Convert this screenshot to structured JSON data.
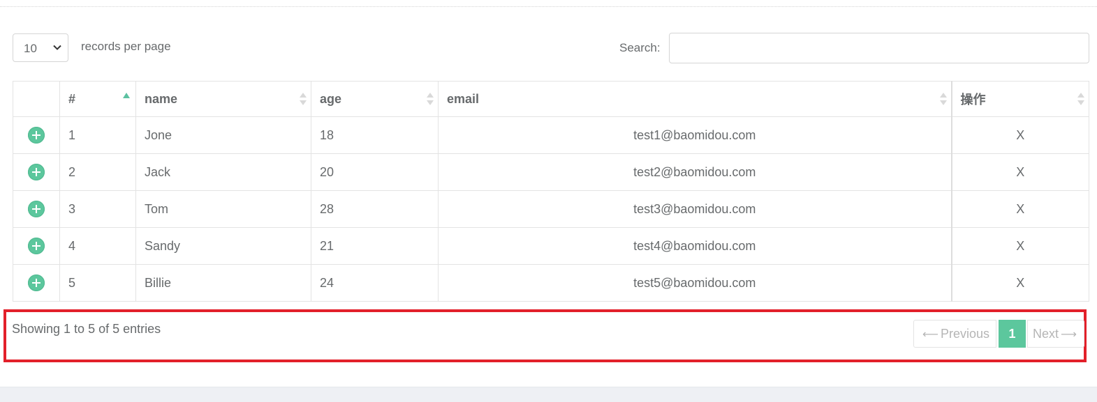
{
  "length_menu": {
    "selected": "10",
    "label": "records per page"
  },
  "search": {
    "label": "Search:",
    "value": "",
    "placeholder": ""
  },
  "table": {
    "columns": [
      "",
      "#",
      "name",
      "age",
      "email",
      "操作"
    ],
    "rows": [
      {
        "id": "1",
        "name": "Jone",
        "age": "18",
        "email": "test1@baomidou.com",
        "action": "X"
      },
      {
        "id": "2",
        "name": "Jack",
        "age": "20",
        "email": "test2@baomidou.com",
        "action": "X"
      },
      {
        "id": "3",
        "name": "Tom",
        "age": "28",
        "email": "test3@baomidou.com",
        "action": "X"
      },
      {
        "id": "4",
        "name": "Sandy",
        "age": "21",
        "email": "test4@baomidou.com",
        "action": "X"
      },
      {
        "id": "5",
        "name": "Billie",
        "age": "24",
        "email": "test5@baomidou.com",
        "action": "X"
      }
    ]
  },
  "info": "Showing 1 to 5 of 5 entries",
  "pagination": {
    "previous": "Previous",
    "current_page": "1",
    "next": "Next",
    "prev_arrow": "⟵",
    "next_arrow": "⟶"
  },
  "colors": {
    "accent": "#5cc79d",
    "highlight_border": "#e2202a",
    "text": "#676a6c",
    "disabled_text": "#b5b5b5"
  },
  "icons": {
    "expand_row": "plus-circle-icon",
    "sort_ascending": "sort-ascending-icon",
    "sort_both": "sort-both-icon",
    "select_chevron": "chevron-down-icon"
  }
}
